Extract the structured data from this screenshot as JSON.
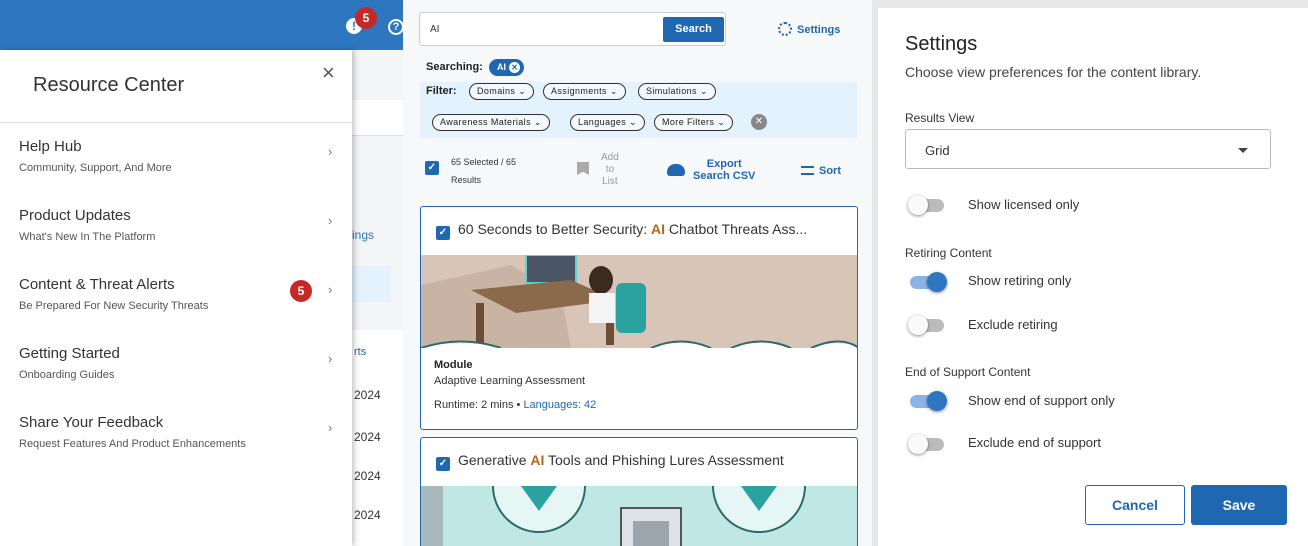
{
  "resource_center": {
    "top_badge_count": "5",
    "help_glyph": "?",
    "title": "Resource Center",
    "close_glyph": "×",
    "items": [
      {
        "title": "Help Hub",
        "subtitle": "Community, Support, And More"
      },
      {
        "title": "Product Updates",
        "subtitle": "What's New In The Platform"
      },
      {
        "title": "Content & Threat Alerts",
        "subtitle": "Be Prepared For New Security Threats",
        "badge": "5"
      },
      {
        "title": "Getting Started",
        "subtitle": "Onboarding Guides"
      },
      {
        "title": "Share Your Feedback",
        "subtitle": "Request Features And Product Enhancements"
      }
    ],
    "background_fragments": {
      "link": "ings",
      "header": "rts",
      "years": [
        "2024",
        "2024",
        "2024",
        "2024"
      ]
    }
  },
  "library": {
    "search": {
      "value": "AI",
      "button": "Search"
    },
    "settings_label": "Settings",
    "searching_label": "Searching:",
    "searching_chip": "AI",
    "filter_label": "Filter:",
    "filters": [
      "Domains",
      "Assignments",
      "Simulations",
      "Awareness Materials",
      "Languages",
      "More Filters"
    ],
    "selected_line1": "65 Selected / 65",
    "selected_line2": "Results",
    "add_to_list": [
      "Add",
      "to",
      "List"
    ],
    "export": [
      "Export",
      "Search CSV"
    ],
    "sort": "Sort",
    "cards": [
      {
        "title_pre": "60 Seconds to Better Security: ",
        "title_hl": "AI",
        "title_post": " Chatbot Threats Ass...",
        "type": "Module",
        "subtitle": "Adaptive Learning Assessment",
        "runtime": "Runtime: 2 mins • ",
        "languages": "Languages: 42"
      },
      {
        "title_pre": "Generative ",
        "title_hl": "AI",
        "title_post": " Tools and Phishing Lures Assessment"
      }
    ]
  },
  "settings": {
    "title": "Settings",
    "description": "Choose view preferences for the content library.",
    "results_view_label": "Results View",
    "results_view_value": "Grid",
    "show_licensed": {
      "label": "Show licensed only",
      "on": false
    },
    "retiring_label": "Retiring Content",
    "show_retiring": {
      "label": "Show retiring only",
      "on": true
    },
    "exclude_retiring": {
      "label": "Exclude retiring",
      "on": false
    },
    "eos_label": "End of Support Content",
    "show_eos": {
      "label": "Show end of support only",
      "on": true
    },
    "exclude_eos": {
      "label": "Exclude end of support",
      "on": false
    },
    "cancel": "Cancel",
    "save": "Save"
  },
  "colors": {
    "primary": "#1f67b1",
    "topbar": "#2e76c0",
    "badge": "#c62828",
    "highlight": "#b5651d",
    "filter_bg": "#e3f2fd"
  }
}
